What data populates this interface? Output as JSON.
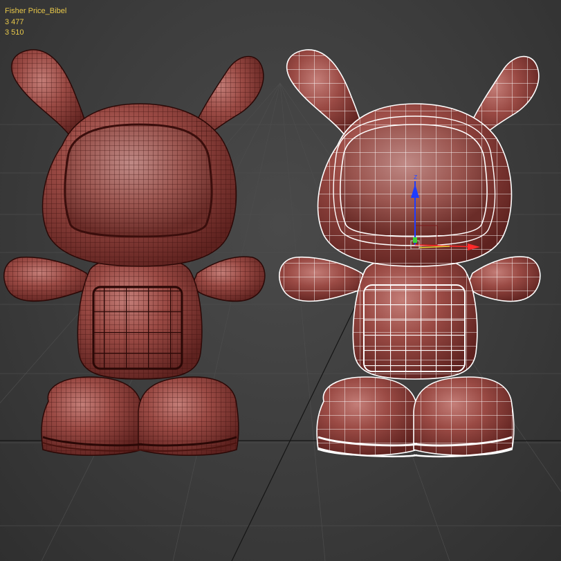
{
  "viewport": {
    "stats": {
      "object_name": "Fisher Price_Bibel",
      "polys": "3 477",
      "verts": "3 510"
    }
  },
  "colors": {
    "background": "#3a3a3a",
    "grid_line": "#4d4d4d",
    "grid_axis": "#151515",
    "model_base": "#9a4a44",
    "model_shade": "#6e2a26",
    "model_highlight": "#c98a84",
    "dense_wire": "#3a0e0c",
    "cage_wire": "#ffffff",
    "stats_text": "#e8c84a",
    "gizmo_z": "#1e3cff",
    "gizmo_x": "#ff2a2a",
    "gizmo_y": "#3ad23a",
    "gizmo_plane": "#e0d030"
  },
  "objects": [
    {
      "name": "dense-mesh-figure",
      "wireframe": "high-density"
    },
    {
      "name": "cage-mesh-figure",
      "wireframe": "low-poly cage",
      "selected": true
    }
  ],
  "gizmo": {
    "axis_label": "z"
  }
}
